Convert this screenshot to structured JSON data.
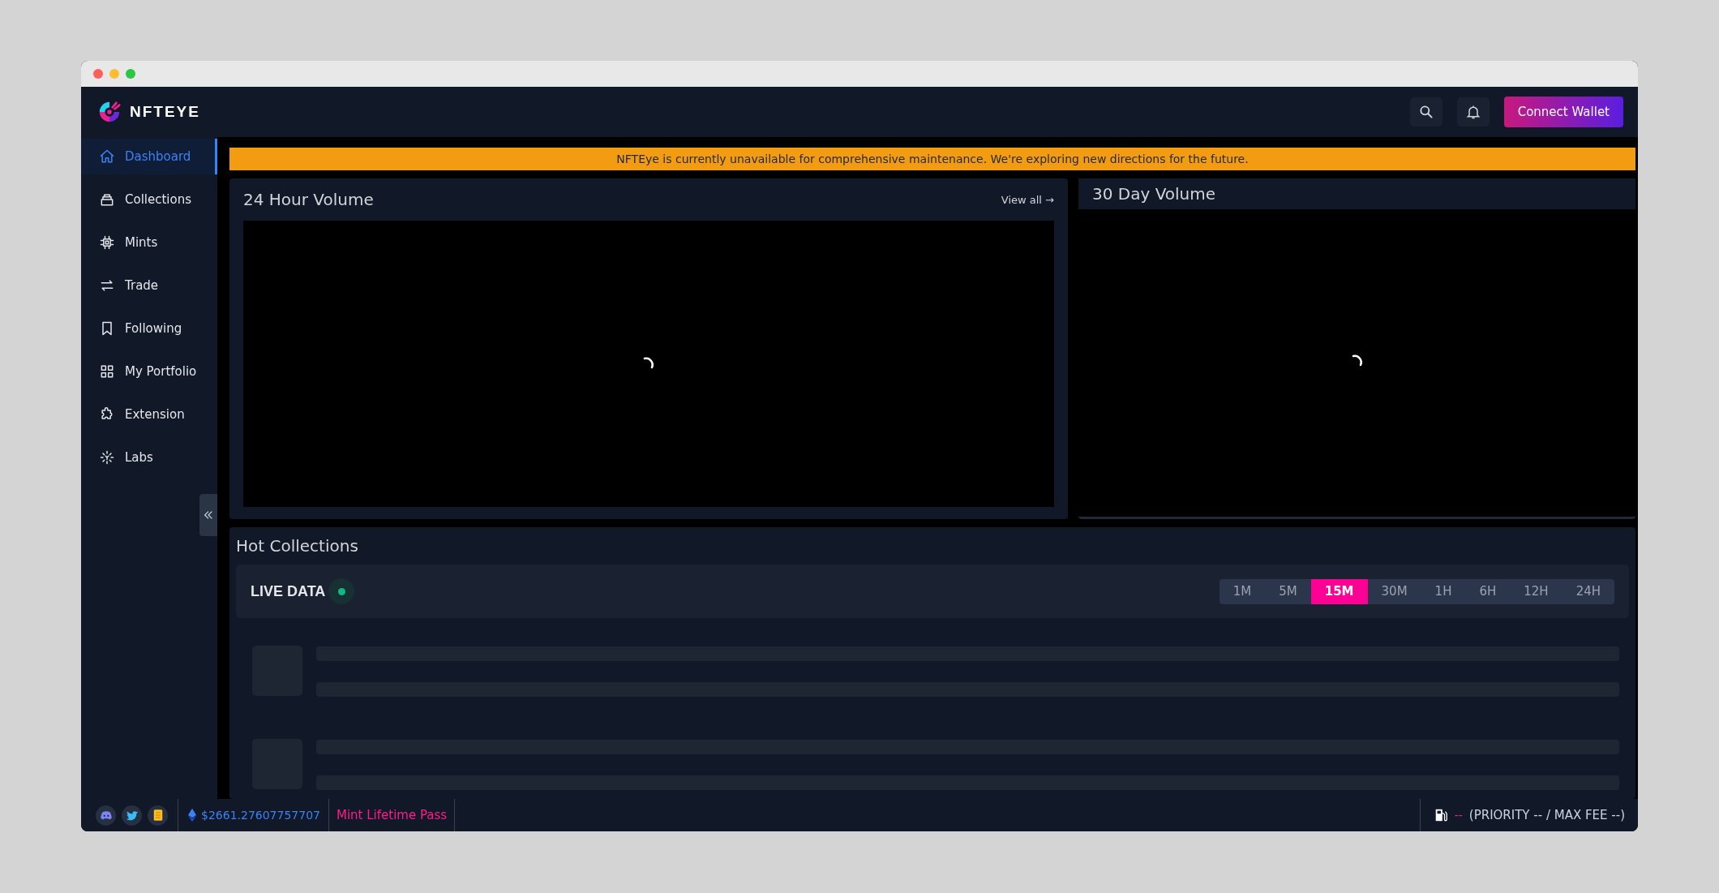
{
  "brand": "NFTEYE",
  "header": {
    "connect_button": "Connect Wallet"
  },
  "sidebar": {
    "items": [
      {
        "label": "Dashboard",
        "selected": true
      },
      {
        "label": "Collections",
        "selected": false
      },
      {
        "label": "Mints",
        "selected": false
      },
      {
        "label": "Trade",
        "selected": false
      },
      {
        "label": "Following",
        "selected": false
      },
      {
        "label": "My Portfolio",
        "selected": false
      },
      {
        "label": "Extension",
        "selected": false
      },
      {
        "label": "Labs",
        "selected": false
      }
    ]
  },
  "banner": "NFTEye is currently unavailable for comprehensive maintenance. We're exploring new directions for the future.",
  "volume_24h": {
    "title": "24 Hour Volume",
    "link": "View all →"
  },
  "volume_30d": {
    "title": "30 Day Volume"
  },
  "hot_collections": {
    "title": "Hot Collections",
    "live_label": "LIVE DATA",
    "timeframes": [
      {
        "label": "1M",
        "selected": false
      },
      {
        "label": "5M",
        "selected": false
      },
      {
        "label": "15M",
        "selected": true
      },
      {
        "label": "30M",
        "selected": false
      },
      {
        "label": "1H",
        "selected": false
      },
      {
        "label": "6H",
        "selected": false
      },
      {
        "label": "12H",
        "selected": false
      },
      {
        "label": "24H",
        "selected": false
      }
    ]
  },
  "footer": {
    "eth_price": "$2661.27607757707",
    "mint_link": "Mint Lifetime Pass",
    "gas_value": "--",
    "gas_detail": "(PRIORITY -- / MAX FEE --)"
  }
}
